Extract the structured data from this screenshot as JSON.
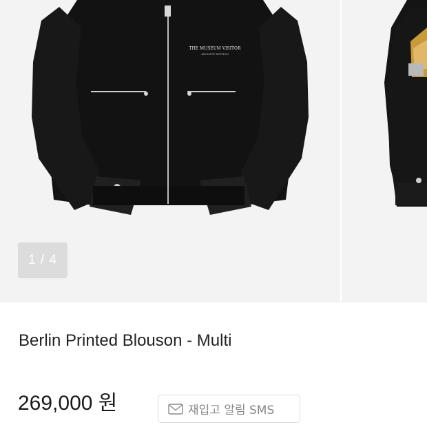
{
  "gallery": {
    "counter": "1 / 4",
    "slides": [
      {
        "alt": "black jacket front",
        "embroidery_line1": "THE MUSEUM VISITOR",
        "embroidery_line2": "ARCHIVE EDITION"
      },
      {
        "alt": "jacket back"
      }
    ]
  },
  "product": {
    "title": "Berlin Printed Blouson - Multi",
    "price": "269,000 원"
  },
  "restock_button": {
    "label": "재입고 알림 SMS",
    "icon": "mail-icon"
  }
}
